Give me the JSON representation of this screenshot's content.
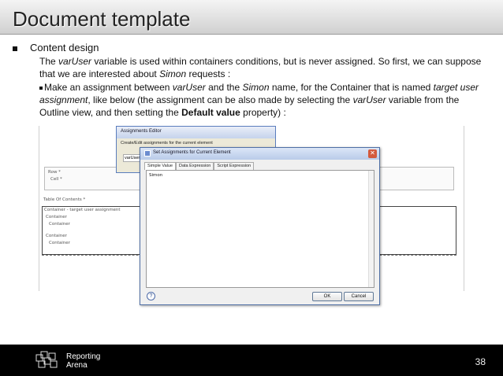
{
  "slide": {
    "title": "Document template",
    "bullet": "Content design",
    "p1": {
      "a": "The ",
      "var1": "varUser",
      "b": " variable is used within containers conditions, but is never assigned.  So first, we can suppose that we are interested about ",
      "simon": "Simon",
      "c": " requests :"
    },
    "p2": {
      "a": "Make an assignment between ",
      "var1": "varUser",
      "b": " and the ",
      "simon": "Simon",
      "c": " name, for the Container that is named ",
      "target": "target user assignment",
      "d": ", like below (the assignment can be also made by selecting the ",
      "var2": "varUser",
      "e": " variable from the Outline view, and then setting the ",
      "default": "Default value",
      "f": " property) :"
    },
    "page_number": "38"
  },
  "screenshot": {
    "bg_labels": {
      "row": "Row *",
      "cell": "Cell *",
      "toc": "Table Of Contents *",
      "container1": "Container",
      "container1_name": "- target user assignment",
      "container2": "Container",
      "container3": "Container",
      "container4": "Container",
      "container5": "Container"
    },
    "editor_window": {
      "title": "Assignments Editor",
      "subtitle": "Create/Edit assignments for the current element",
      "tag": "varUser"
    },
    "set_window": {
      "title": "Set Assignments for Current Element",
      "tabs": [
        "Simple Value",
        "Data Expression",
        "Script Expression"
      ],
      "value": "Simon",
      "help": "?",
      "ok": "OK",
      "cancel": "Cancel"
    }
  },
  "footer": {
    "logo_line1": "Reporting",
    "logo_line2": "Arena"
  }
}
